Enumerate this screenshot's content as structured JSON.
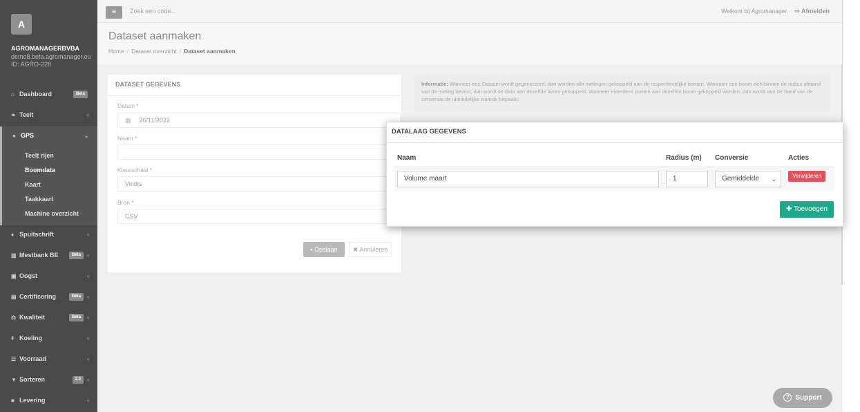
{
  "sidebar": {
    "avatar_letter": "A",
    "company": "AGROMANAGERBVBA",
    "email": "demo8.beta.agromanager.eu",
    "id": "ID: AGRO-228",
    "items": [
      {
        "label": "Dashboard",
        "icon": "home-icon",
        "badge": "Beta"
      },
      {
        "label": "Teelt",
        "icon": "leaf-icon"
      },
      {
        "label": "GPS",
        "icon": "map-marker-icon"
      },
      {
        "label": "Spuitschrift",
        "icon": "drop-icon"
      },
      {
        "label": "Mestbank BE",
        "icon": "bank-icon",
        "badge": "Bèta"
      },
      {
        "label": "Oogst",
        "icon": "basket-icon"
      },
      {
        "label": "Certificering",
        "icon": "book-icon",
        "badge": "Bèta"
      },
      {
        "label": "Kwaliteit",
        "icon": "scale-icon",
        "badge": "Bèta"
      },
      {
        "label": "Koeling",
        "icon": "thermometer-icon"
      },
      {
        "label": "Voorraad",
        "icon": "list-icon"
      },
      {
        "label": "Sorteren",
        "icon": "filter-icon",
        "badge": "2.0"
      },
      {
        "label": "Levering",
        "icon": "truck-icon"
      }
    ],
    "gps_sub": [
      "Teelt rijen",
      "Boomdata",
      "Kaart",
      "Taakkaart",
      "Machine overzicht"
    ]
  },
  "topbar": {
    "search_placeholder": "Zoek een code...",
    "welcome": "Welkom bij Agromanager.",
    "logout": "Afmelden"
  },
  "page": {
    "title": "Dataset aanmaken",
    "breadcrumb": [
      "Home",
      "Dataset overzicht",
      "Dataset aanmaken"
    ]
  },
  "dataset": {
    "panel_title": "DATASET GEGEVENS",
    "datum_label": "Datum *",
    "datum_value": "26/11/2022",
    "naam_label": "Naam *",
    "naam_value": "",
    "kleurschaal_label": "Kleurschaal *",
    "kleurschaal_value": "Viridis",
    "bron_label": "Bron *",
    "bron_value": "CSV",
    "save_label": "Opslaan",
    "cancel_label": "Annuleren"
  },
  "info": {
    "heading": "Informatie:",
    "text": "Wanneer een Dataset wordt gegenereerd, dan worden alle metingen gekoppeld aan de respectievelijke bomen. Wanneer een boom zich binnen de radius afstand van de meting bevind, dan wordt de data aan dezelfde boom gekoppeld. Wanneer meerdere punten aan dezelfde boom gekoppeld worden, dan wordt aan de hand van de conversie de uiteindelijke waarde bepaald."
  },
  "modal": {
    "title": "DATALAAG GEGEVENS",
    "col_naam": "Naam",
    "col_radius": "Radius (m)",
    "col_conversie": "Conversie",
    "col_acties": "Acties",
    "row": {
      "naam": "Volume maart",
      "radius": "1",
      "conversie": "Gemiddelde"
    },
    "delete_label": "Verwijderen",
    "add_label": "Toevoegen"
  },
  "support_label": "Support"
}
